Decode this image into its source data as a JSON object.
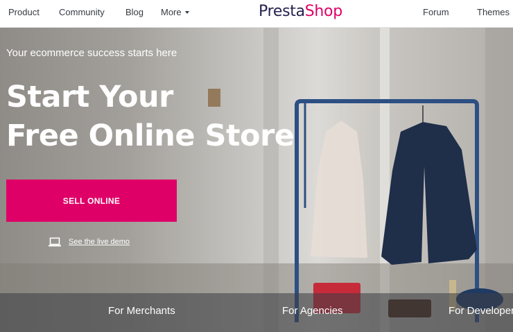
{
  "nav": {
    "left_items": [
      {
        "label": "Product"
      },
      {
        "label": "Community"
      },
      {
        "label": "Blog"
      },
      {
        "label": "More"
      }
    ],
    "logo": {
      "part1": "Presta",
      "part2": "Shop"
    },
    "right_items": [
      {
        "label": "Forum"
      },
      {
        "label": "Themes"
      }
    ]
  },
  "hero": {
    "tagline": "Your ecommerce success starts here",
    "headline_line1": "Start Your",
    "headline_line2": "Free Online Store",
    "cta_label": "SELL ONLINE",
    "demo_label": "See the live demo",
    "demo_icon": "laptop-icon"
  },
  "audience_tabs": [
    {
      "label": "For Merchants"
    },
    {
      "label": "For Agencies"
    },
    {
      "label": "For Developers"
    }
  ],
  "colors": {
    "brand_pink": "#df0067",
    "brand_navy": "#25214f",
    "nav_text": "#363a41"
  }
}
